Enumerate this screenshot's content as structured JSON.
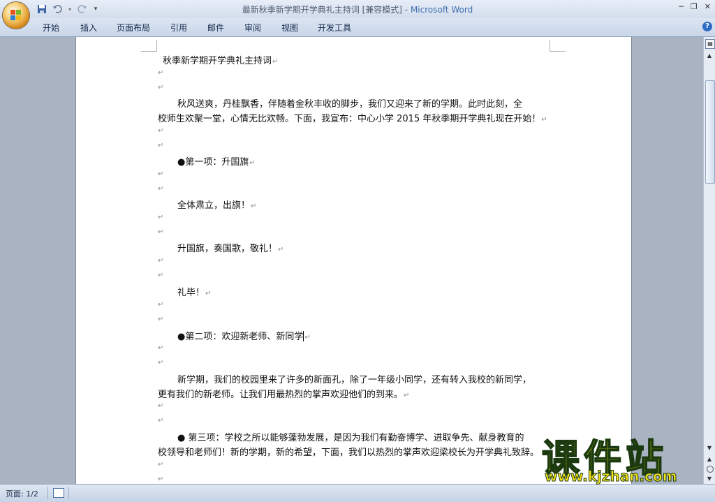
{
  "window": {
    "title_doc": "最新秋季新学期开学典礼主持词 [兼容模式]",
    "title_sep": " - ",
    "title_app": "Microsoft Word"
  },
  "qat": {
    "save_icon": "save-icon",
    "undo_icon": "undo-icon",
    "redo_icon": "redo-icon",
    "customize": "▾"
  },
  "ribbon": {
    "tabs": [
      "开始",
      "插入",
      "页面布局",
      "引用",
      "邮件",
      "审阅",
      "视图",
      "开发工具"
    ]
  },
  "document": {
    "title": "秋季新学期开学典礼主持词",
    "p1_l1": "秋风送爽，丹桂飘香，伴随着金秋丰收的脚步，我们又迎来了新的学期。此时此刻，全",
    "p1_l2": "校师生欢聚一堂，心情无比欢畅。下面，我宣布：中心小学 2015 年秋季期开学典礼现在开始！",
    "item1": "●第一项：升国旗",
    "item1_a": "全体肃立，出旗！",
    "item1_b": "升国旗，奏国歌，敬礼！",
    "item1_c": "礼毕！",
    "item2": "●第二项：欢迎新老师、新同学",
    "p2_l1": "新学期，我们的校园里来了许多的新面孔，除了一年级小同学，还有转入我校的新同学，",
    "p2_l2": "更有我们的新老师。让我们用最热烈的掌声欢迎他们的到来。",
    "item3_l1": "● 第三项：学校之所以能够蓬勃发展，是因为我们有勤奋博学、进取争先、献身教育的",
    "item3_l2": "校领导和老师们！新的学期，新的希望，下面，我们以热烈的掌声欢迎梁校长为开学典礼致辞。",
    "paragraph_mark": "↵"
  },
  "status_bar": {
    "page": "页面: 1/2"
  },
  "watermark": {
    "text": "课件站",
    "url": "www.kjzhan.com"
  },
  "colors": {
    "accent": "#3f6fb0",
    "watermark": "#f4e21a"
  }
}
